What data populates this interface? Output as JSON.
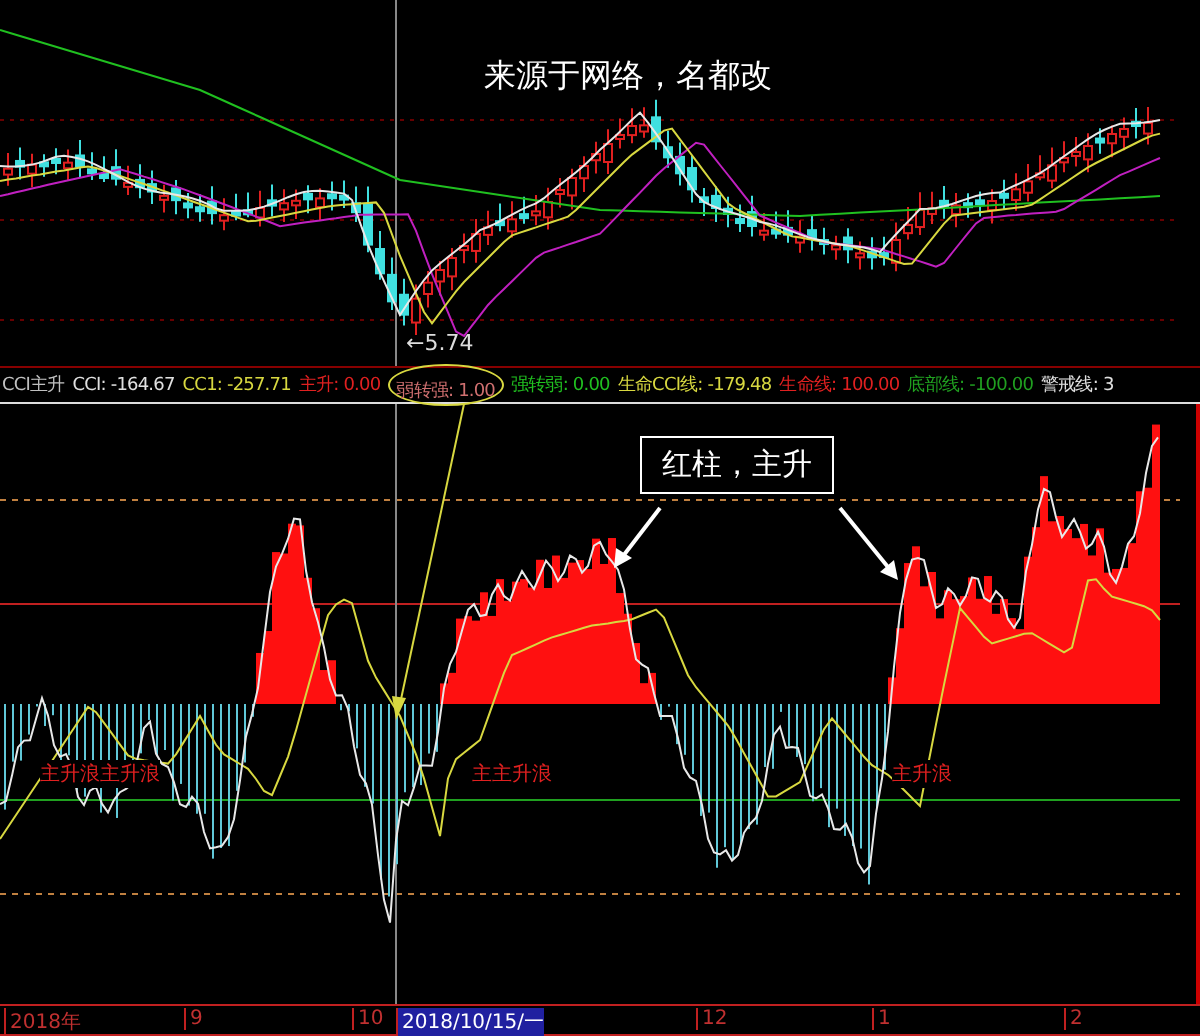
{
  "price_panel": {
    "note": "来源于网络，名都改",
    "low_label": "←5.74"
  },
  "indicator_panel": {
    "legend": [
      {
        "text": "CCI主升",
        "color": "#c0c0c0",
        "circled": false
      },
      {
        "text": "CCI: -164.67",
        "color": "#e0e0e0",
        "circled": false
      },
      {
        "text": "CC1: -257.71",
        "color": "#d8d840",
        "circled": false
      },
      {
        "text": "主升: 0.00",
        "color": "#e02020",
        "circled": false
      },
      {
        "text": "弱转强: 1.00",
        "color": "#d07070",
        "circled": true
      },
      {
        "text": "强转弱: 0.00",
        "color": "#20c020",
        "circled": false
      },
      {
        "text": "生命CCI线: -179.48",
        "color": "#d8d840",
        "circled": false
      },
      {
        "text": "生命线: 100.00",
        "color": "#e02020",
        "circled": false
      },
      {
        "text": "底部线: -100.00",
        "color": "#20a020",
        "circled": false
      },
      {
        "text": "警戒线: 3",
        "color": "#e0e0e0",
        "circled": false
      }
    ],
    "annotation": "红柱，主升",
    "wave_labels": [
      "主升浪主升浪",
      "主主升浪",
      "主升浪"
    ]
  },
  "time_axis": [
    {
      "label": "2018年",
      "selected": false
    },
    {
      "label": "9",
      "selected": false
    },
    {
      "label": "10",
      "selected": false
    },
    {
      "label": "2018/10/15/一",
      "selected": true
    },
    {
      "label": "12",
      "selected": false
    },
    {
      "label": "1",
      "selected": false
    },
    {
      "label": "2",
      "selected": false
    }
  ]
}
